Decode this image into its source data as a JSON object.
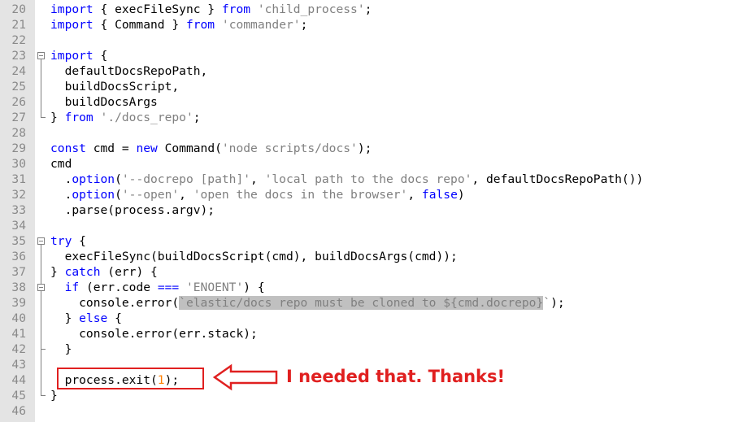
{
  "editor": {
    "lines": [
      {
        "n": "20",
        "tokens": [
          {
            "t": "import",
            "c": "kw"
          },
          {
            "t": " { execFileSync } "
          },
          {
            "t": "from",
            "c": "kw"
          },
          {
            "t": " "
          },
          {
            "t": "'child_process'",
            "c": "str"
          },
          {
            "t": ";"
          }
        ]
      },
      {
        "n": "21",
        "tokens": [
          {
            "t": "import",
            "c": "kw"
          },
          {
            "t": " { Command } "
          },
          {
            "t": "from",
            "c": "kw"
          },
          {
            "t": " "
          },
          {
            "t": "'commander'",
            "c": "str"
          },
          {
            "t": ";"
          }
        ]
      },
      {
        "n": "22",
        "tokens": []
      },
      {
        "n": "23",
        "tokens": [
          {
            "t": "import",
            "c": "kw"
          },
          {
            "t": " {"
          }
        ]
      },
      {
        "n": "24",
        "tokens": [
          {
            "t": "  defaultDocsRepoPath,"
          }
        ]
      },
      {
        "n": "25",
        "tokens": [
          {
            "t": "  buildDocsScript,"
          }
        ]
      },
      {
        "n": "26",
        "tokens": [
          {
            "t": "  buildDocsArgs"
          }
        ]
      },
      {
        "n": "27",
        "tokens": [
          {
            "t": "} "
          },
          {
            "t": "from",
            "c": "kw"
          },
          {
            "t": " "
          },
          {
            "t": "'./docs_repo'",
            "c": "str"
          },
          {
            "t": ";"
          }
        ]
      },
      {
        "n": "28",
        "tokens": []
      },
      {
        "n": "29",
        "tokens": [
          {
            "t": "const",
            "c": "kw"
          },
          {
            "t": " cmd = "
          },
          {
            "t": "new",
            "c": "kw"
          },
          {
            "t": " Command("
          },
          {
            "t": "'node scripts/docs'",
            "c": "str"
          },
          {
            "t": ");"
          }
        ]
      },
      {
        "n": "30",
        "tokens": [
          {
            "t": "cmd"
          }
        ]
      },
      {
        "n": "31",
        "tokens": [
          {
            "t": "  ."
          },
          {
            "t": "option",
            "c": "kw"
          },
          {
            "t": "("
          },
          {
            "t": "'--docrepo [path]'",
            "c": "str"
          },
          {
            "t": ", "
          },
          {
            "t": "'local path to the docs repo'",
            "c": "str"
          },
          {
            "t": ", defaultDocsRepoPath())"
          }
        ]
      },
      {
        "n": "32",
        "tokens": [
          {
            "t": "  ."
          },
          {
            "t": "option",
            "c": "kw"
          },
          {
            "t": "("
          },
          {
            "t": "'--open'",
            "c": "str"
          },
          {
            "t": ", "
          },
          {
            "t": "'open the docs in the browser'",
            "c": "str"
          },
          {
            "t": ", "
          },
          {
            "t": "false",
            "c": "kw"
          },
          {
            "t": ")"
          }
        ]
      },
      {
        "n": "33",
        "tokens": [
          {
            "t": "  .parse(process.argv);"
          }
        ]
      },
      {
        "n": "34",
        "tokens": []
      },
      {
        "n": "35",
        "tokens": [
          {
            "t": "try",
            "c": "kw"
          },
          {
            "t": " {"
          }
        ]
      },
      {
        "n": "36",
        "tokens": [
          {
            "t": "  execFileSync(buildDocsScript(cmd), buildDocsArgs(cmd));"
          }
        ]
      },
      {
        "n": "37",
        "tokens": [
          {
            "t": "} "
          },
          {
            "t": "catch",
            "c": "kw"
          },
          {
            "t": " (err) {"
          }
        ]
      },
      {
        "n": "38",
        "tokens": [
          {
            "t": "  "
          },
          {
            "t": "if",
            "c": "kw"
          },
          {
            "t": " (err.code "
          },
          {
            "t": "===",
            "c": "kw"
          },
          {
            "t": " "
          },
          {
            "t": "'ENOENT'",
            "c": "str"
          },
          {
            "t": ") {"
          }
        ]
      },
      {
        "n": "39",
        "tokens": [
          {
            "t": "    console.error("
          },
          {
            "t": "`elastic/docs repo must be cloned to ${cmd.docrepo}",
            "c": "str hl"
          },
          {
            "t": "`",
            "c": "str"
          },
          {
            "t": ");"
          }
        ]
      },
      {
        "n": "40",
        "tokens": [
          {
            "t": "  } "
          },
          {
            "t": "else",
            "c": "kw"
          },
          {
            "t": " {"
          }
        ]
      },
      {
        "n": "41",
        "tokens": [
          {
            "t": "    console.error(err.stack);"
          }
        ]
      },
      {
        "n": "42",
        "tokens": [
          {
            "t": "  }"
          }
        ]
      },
      {
        "n": "43",
        "tokens": []
      },
      {
        "n": "44",
        "tokens": [
          {
            "t": "  process.exit("
          },
          {
            "t": "1",
            "c": "num"
          },
          {
            "t": ");"
          }
        ]
      },
      {
        "n": "45",
        "tokens": [
          {
            "t": "}"
          }
        ]
      },
      {
        "n": "46",
        "tokens": []
      }
    ]
  },
  "annotation": {
    "text": "I needed that. Thanks!",
    "color": "#e02020"
  },
  "colors": {
    "keyword": "#0000ff",
    "string": "#808080",
    "number": "#ff8000",
    "gutter": "#e4e4e4"
  }
}
